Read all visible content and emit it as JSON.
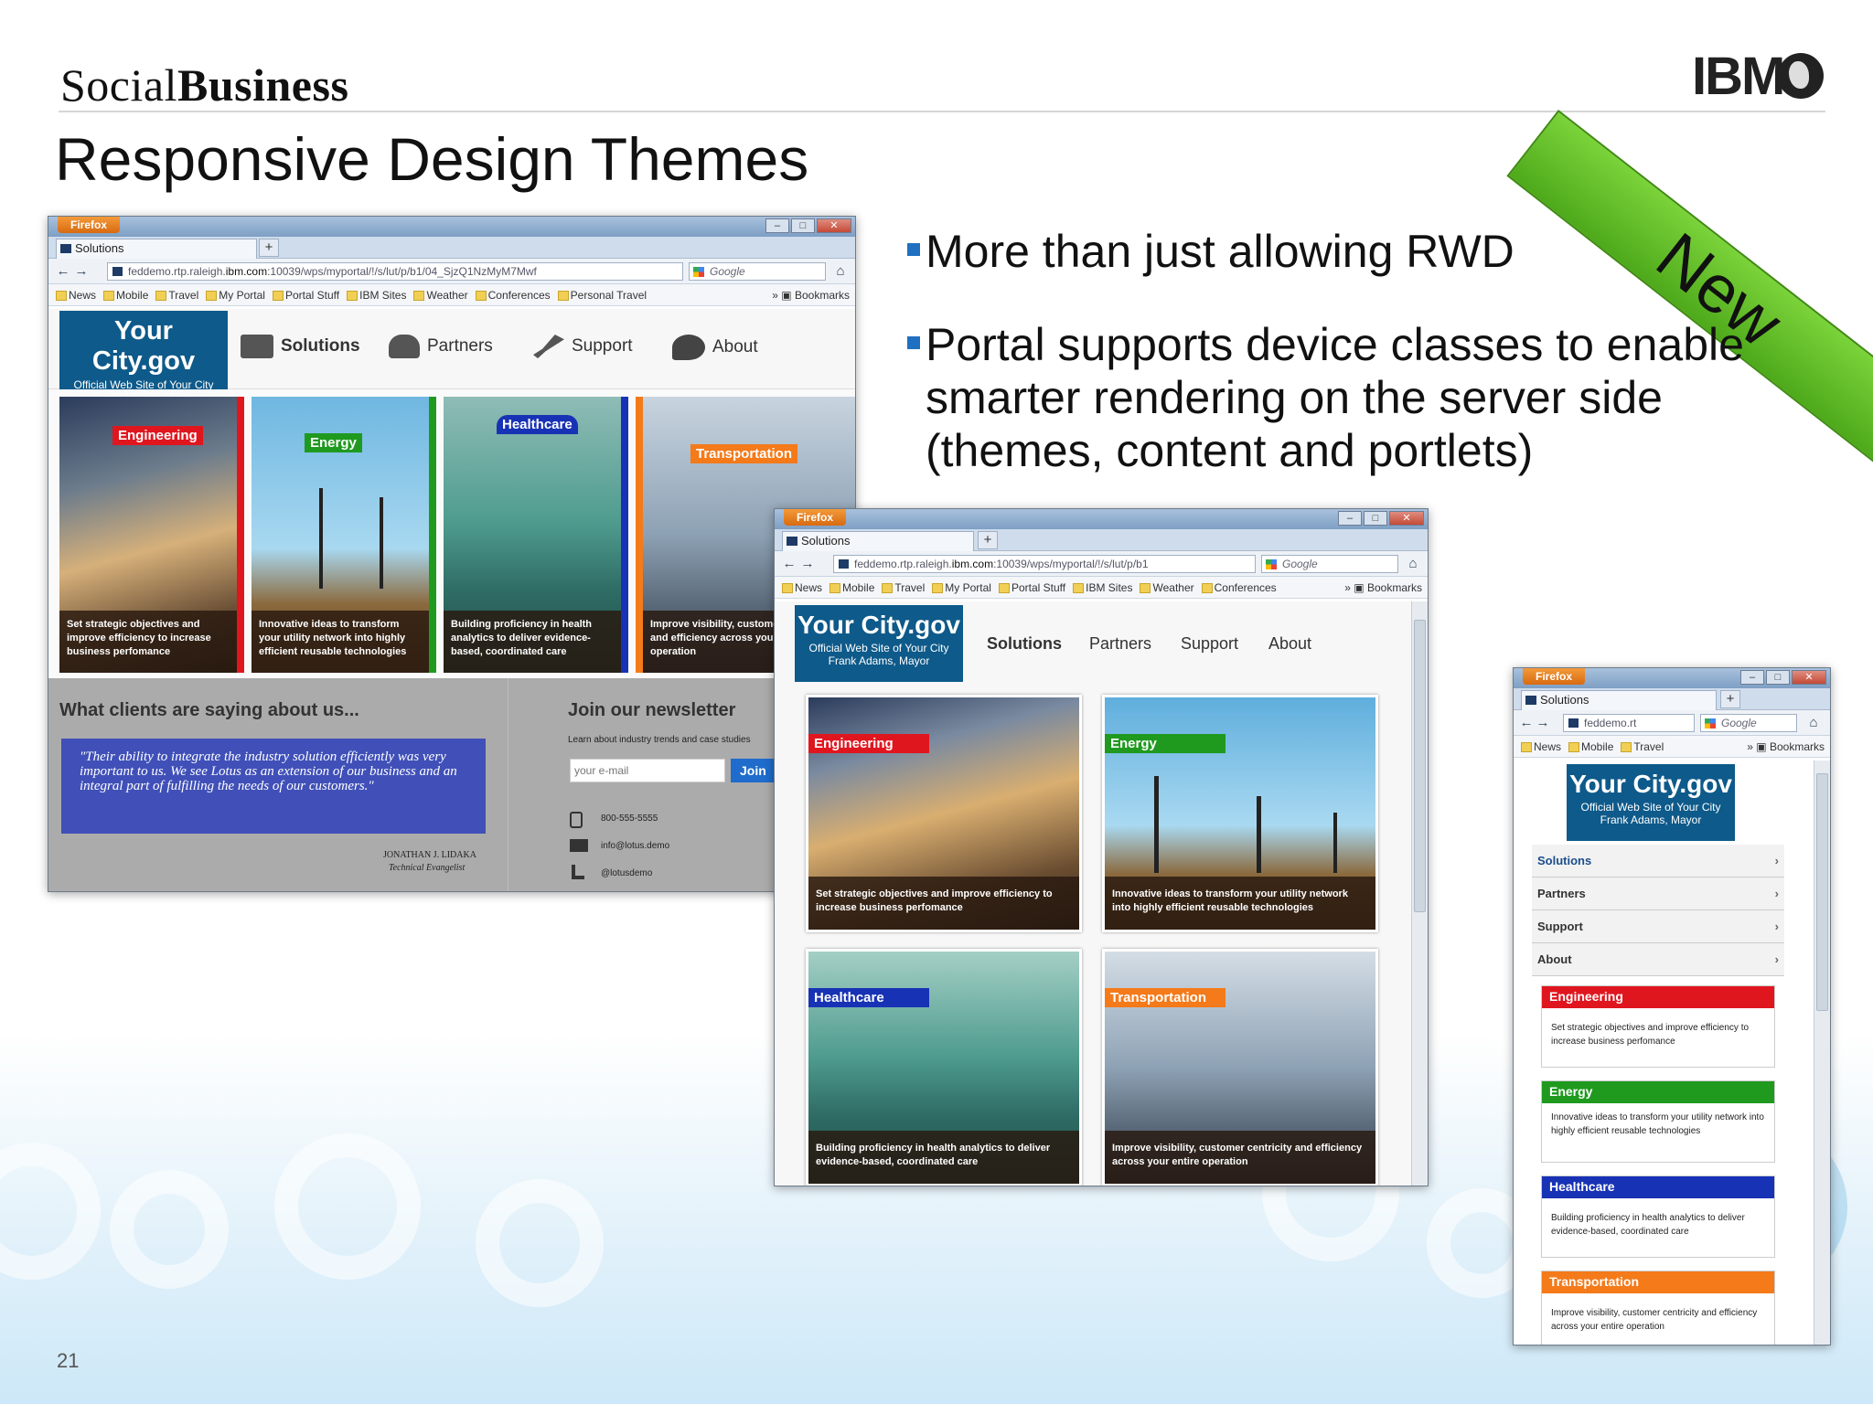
{
  "slide": {
    "brand_light": "Social",
    "brand_bold": "Business",
    "title": "Responsive Design Themes",
    "corner_logo": "IBM",
    "new_ribbon": "New",
    "page_number": "21",
    "bullets": [
      "More than just allowing RWD",
      "Portal supports device classes to enable smarter rendering on the server side (themes, content and portlets)"
    ]
  },
  "browser": {
    "firefox_label": "Firefox",
    "tab_label": "Solutions",
    "new_tab": "+",
    "search_placeholder": "Google",
    "bookmarks_label": "Bookmarks",
    "bookmarks_full": [
      "News",
      "Mobile",
      "Travel",
      "My Portal",
      "Portal Stuff",
      "IBM Sites",
      "Weather",
      "Conferences",
      "Personal Travel"
    ],
    "bookmarks_medium": [
      "News",
      "Mobile",
      "Travel",
      "My Portal",
      "Portal Stuff",
      "IBM Sites",
      "Weather",
      "Conferences"
    ],
    "bookmarks_small": [
      "News",
      "Mobile",
      "Travel"
    ],
    "url_desktop_pre": "feddemo.rtp.raleigh.",
    "url_desktop_domain": "ibm.com",
    "url_desktop_post": ":10039/wps/myportal/!/s/lut/p/b1/04_SjzQ1NzMyM7Mwf",
    "url_tablet_pre": "feddemo.rtp.raleigh.",
    "url_tablet_domain": "ibm.com",
    "url_tablet_post": ":10039/wps/myportal/!/s/lut/p/b1",
    "url_phone": "feddemo.rt"
  },
  "site": {
    "logo_main": "Your City.gov",
    "logo_sub": "Official Web Site of Your City",
    "logo_mayor": "Frank Adams, Mayor",
    "nav": [
      "Solutions",
      "Partners",
      "Support",
      "About"
    ],
    "panels": [
      {
        "tag": "Engineering",
        "caption": "Set strategic objectives and improve efficiency to increase business perfomance"
      },
      {
        "tag": "Energy",
        "caption": "Innovative ideas to transform your utility network into highly efficient reusable technologies"
      },
      {
        "tag": "Healthcare",
        "caption": "Building proficiency in health analytics to deliver evidence-based, coordinated care"
      },
      {
        "tag": "Transportation",
        "caption": "Improve visibility, customer centricity and efficiency across your entire operation"
      }
    ],
    "testimonial_heading": "What clients are saying about us...",
    "testimonial_quote": "\"Their ability to integrate the industry solution efficiently was very important to us. We see Lotus as an extension of our business and an integral part of fulfilling the needs of our customers.\"",
    "testimonial_author": "JONATHAN J. LIDAKA",
    "testimonial_role": "Technical Evangelist",
    "newsletter_heading": "Join our newsletter",
    "newsletter_text": "Learn about industry trends and case studies",
    "email_placeholder": "your e-mail",
    "join_button": "Join",
    "phone": "800-555-5555",
    "email": "info@lotus.demo",
    "twitter": "@lotusdemo"
  },
  "colors": {
    "engineering": "#e0161f",
    "energy": "#1f9a1f",
    "healthcare": "#1832b5",
    "transportation": "#f47a1a",
    "logo_blue": "#0e5a8a",
    "bullet": "#1f70c1",
    "ribbon": "#5cbd24"
  }
}
